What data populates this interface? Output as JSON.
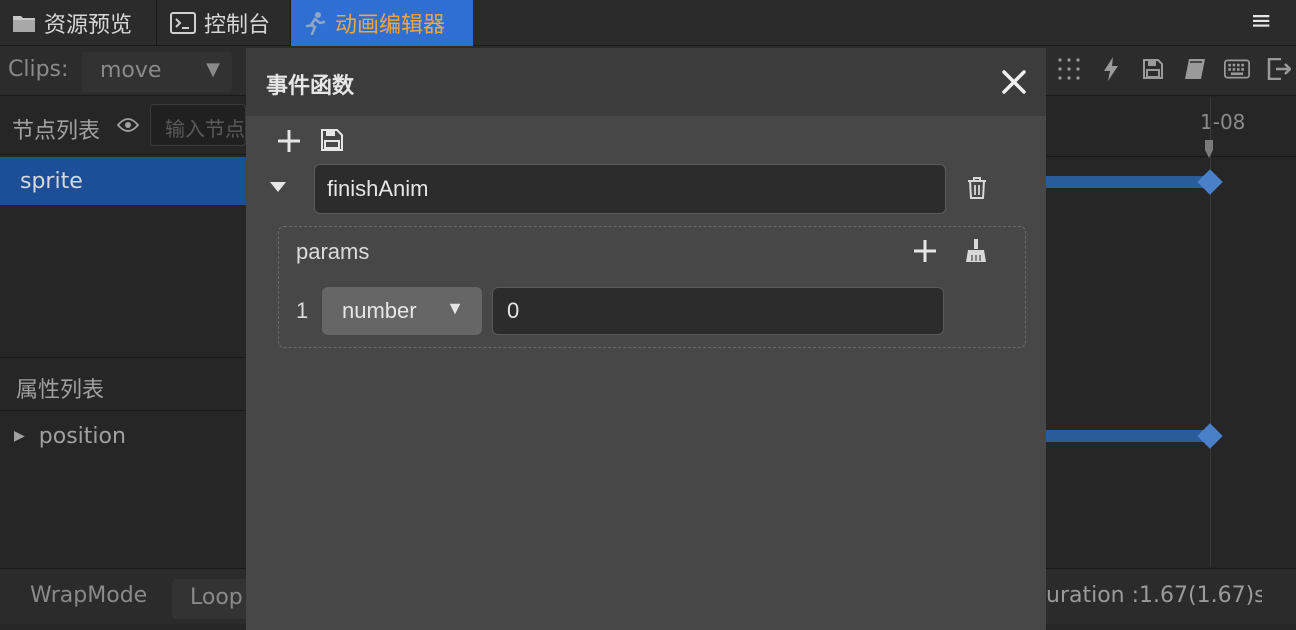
{
  "tabs": [
    {
      "label": "资源预览",
      "icon": "folder-icon"
    },
    {
      "label": "控制台",
      "icon": "terminal-icon"
    },
    {
      "label": "动画编辑器",
      "icon": "animation-runner-icon",
      "active": true
    }
  ],
  "menu_icon": "≡",
  "toolbar": {
    "clips_label": "Clips:",
    "clip_selected": "move",
    "caret": "▼"
  },
  "node_panel": {
    "title": "节点列表",
    "search_placeholder": "输入节点",
    "nodes": [
      "sprite"
    ]
  },
  "property_panel": {
    "title": "属性列表",
    "properties": [
      "position"
    ]
  },
  "timeline": {
    "time_mark": "1-08"
  },
  "footer": {
    "wrap_mode_label": "WrapMode",
    "wrap_mode_value": "Loop",
    "duration_text": "uration :1.67(1.67)s"
  },
  "modal": {
    "title": "事件函数",
    "function_name": "finishAnim",
    "params_label": "params",
    "params": [
      {
        "index": "1",
        "type": "number",
        "value": "0"
      }
    ]
  },
  "colors": {
    "active_tab_bg": "#2f6fd1",
    "active_tab_text": "#f0a640",
    "selected_row": "#1c4f98",
    "keyframe": "#4a80c8"
  }
}
